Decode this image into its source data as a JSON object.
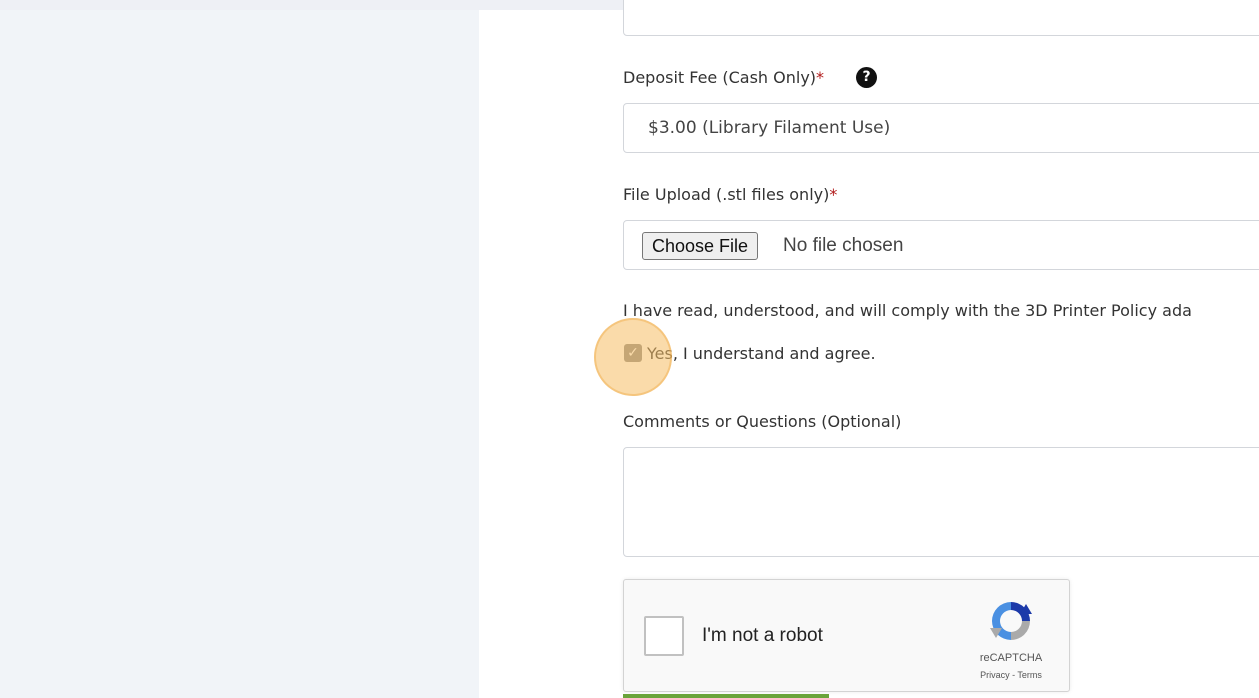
{
  "deposit": {
    "label": "Deposit Fee (Cash Only)",
    "required_mark": "*",
    "help_icon": "?",
    "selected": "$3.00 (Library Filament Use)"
  },
  "upload": {
    "label": "File Upload (.stl files only)",
    "required_mark": "*",
    "button_label": "Choose File",
    "status": "No file chosen"
  },
  "policy": {
    "text": "I have read, understood, and will comply with the 3D Printer Policy ada",
    "checkbox_label": "Yes, I understand and agree.",
    "checkbox_mark": "✓",
    "checked": true
  },
  "comments": {
    "label": "Comments or Questions (Optional)",
    "value": ""
  },
  "captcha": {
    "label": "I'm not a robot",
    "brand": "reCAPTCHA",
    "links": "Privacy - Terms"
  },
  "colors": {
    "accent": "#6aa43a",
    "required": "#b11a1a",
    "click_highlight": "#f5be64"
  }
}
